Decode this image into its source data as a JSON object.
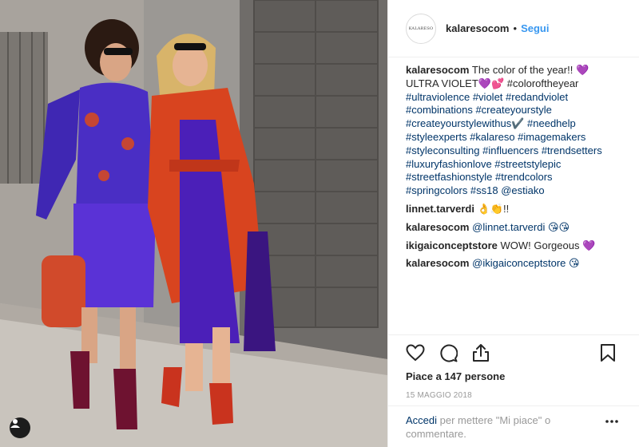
{
  "header": {
    "avatar_text": "KALARESO",
    "username": "kalaresocom",
    "separator": "•",
    "follow_label": "Segui"
  },
  "caption": {
    "username": "kalaresocom",
    "lines": [
      "The color of the year!! 💜",
      "ULTRA VIOLET💜💕 #coloroftheyear",
      "#ultraviolence #violet #redandviolet",
      "#combinations #createyourstyle",
      "#createyourstylewithus✔️ #needhelp",
      "#styleexperts #kalareso #imagemakers",
      "#styleconsulting #influencers #trendsetters",
      "#luxuryfashionlove #streetstylepic",
      "#streetfashionstyle #trendcolors",
      "#springcolors #ss18 @estiako"
    ]
  },
  "comments": [
    {
      "user": "linnet.tarverdi",
      "text": "👌👏!!"
    },
    {
      "user": "kalaresocom",
      "text": "@linnet.tarverdi 😘😘"
    },
    {
      "user": "ikigaiconceptstore",
      "text": "WOW! Gorgeous 💜"
    },
    {
      "user": "kalaresocom",
      "text": "@ikigaiconceptstore 😘"
    }
  ],
  "icons": [
    "heart-icon",
    "comment-icon",
    "share-icon",
    "bookmark-icon",
    "more-icon",
    "user-icon"
  ],
  "likes": "Piace a 147 persone",
  "date": "15 MAGGIO 2018",
  "add_comment": {
    "login_label": "Accedi",
    "rest": "per mettere \"Mi piace\" o commentare."
  },
  "colors": {
    "link": "#003569",
    "follow": "#3897f0",
    "text": "#262626",
    "muted": "#999999",
    "violet_dress": "#4b1fb8",
    "red_coat": "#d8441f"
  }
}
